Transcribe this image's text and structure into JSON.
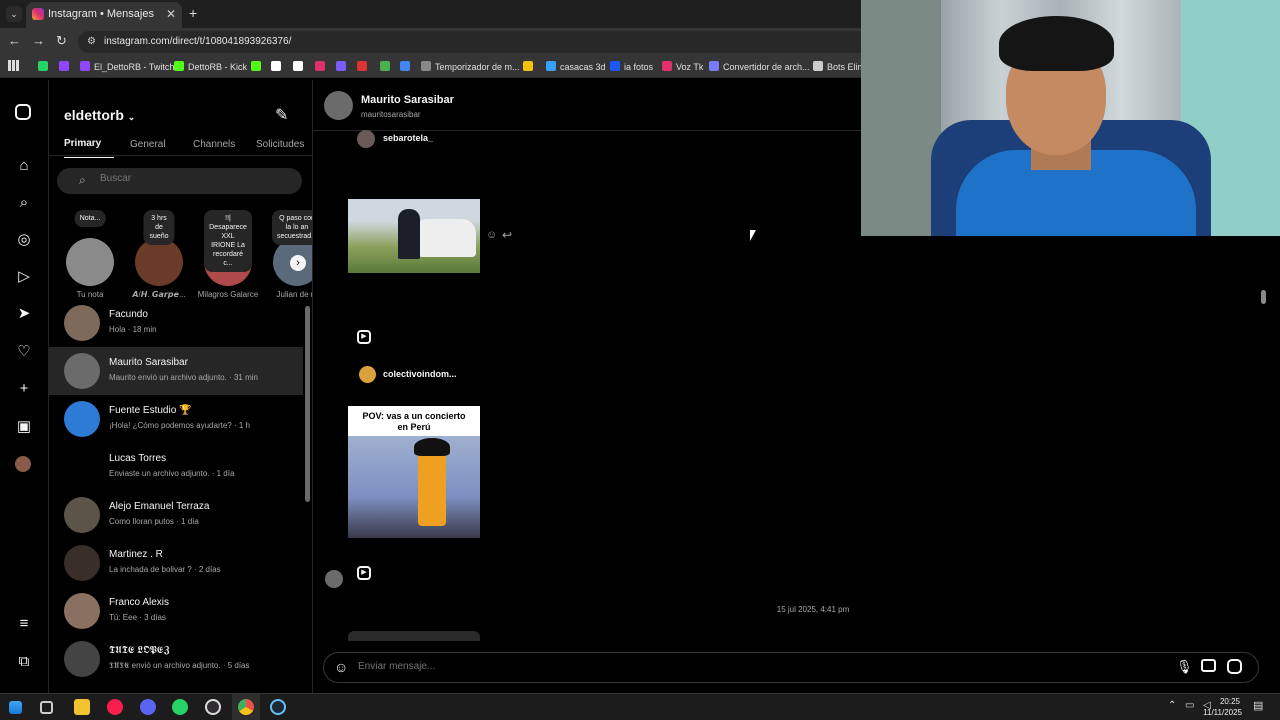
{
  "browser": {
    "tab_title": "Instagram • Mensajes",
    "url": "instagram.com/direct/t/108041893926376/",
    "bookmarks": [
      {
        "label": "",
        "color": "#25d366"
      },
      {
        "label": "",
        "color": "#9146ff"
      },
      {
        "label": "El_DettoRB - Twitch",
        "color": "#9146ff"
      },
      {
        "label": "DettoRB - Kick",
        "color": "#53fc18"
      },
      {
        "label": "",
        "color": "#53fc18"
      },
      {
        "label": "",
        "color": "#ffffff"
      },
      {
        "label": "",
        "color": "#ffffff"
      },
      {
        "label": "",
        "color": "#e1306c"
      },
      {
        "label": "",
        "color": "#7b5cff"
      },
      {
        "label": "",
        "color": "#d33"
      },
      {
        "label": "",
        "color": "#4caf50"
      },
      {
        "label": "",
        "color": "#4285f4"
      },
      {
        "label": "Temporizador de m...",
        "color": "#888888"
      },
      {
        "label": "",
        "color": "#f4c20d"
      },
      {
        "label": "casacas 3d",
        "color": "#3aa0ff"
      },
      {
        "label": "ia fotos",
        "color": "#1c57ff"
      },
      {
        "label": "Voz Tk",
        "color": "#e1306c"
      },
      {
        "label": "Convertidor de arch...",
        "color": "#7a7aff"
      },
      {
        "label": "Bots Elim",
        "color": "#cccccc"
      }
    ]
  },
  "inbox": {
    "username": "eldettorb",
    "tabs": [
      "Primary",
      "General",
      "Channels",
      "Solicitudes"
    ],
    "search_placeholder": "Buscar",
    "stories": [
      {
        "note": "Nota...",
        "name": "Tu nota",
        "color": "#8a8a8a"
      },
      {
        "note": "3 hrs de sueño",
        "name": "𝘼/𝙃. 𝙂𝙖𝙧𝙥𝙚...",
        "color": "#6b3b2a"
      },
      {
        "note": "!!| Desaparece XXL IRIONE La recordaré c...",
        "name": "Milagros Galarce",
        "color": "#b04a4a"
      },
      {
        "note": "Q paso con la lo an secuestrad...",
        "name": "Julian de m",
        "color": "#5a6a7a"
      }
    ],
    "conversations": [
      {
        "name": "Facundo",
        "preview": "Hola · 18 min",
        "color": "#7d6a5a"
      },
      {
        "name": "Maurito Sarasibar",
        "preview": "Maurito envió un archivo adjunto. · 31 min",
        "color": "#6b6b6b"
      },
      {
        "name": "Fuente Estudio 🏆",
        "preview": "¡Hola! ¿Cómo podemos ayudarte? · 1 h",
        "color": "#2e7bd6"
      },
      {
        "name": "Lucas Torres",
        "preview": "Enviaste un archivo adjunto. · 1 día",
        "color": "#000000"
      },
      {
        "name": "Alejo Emanuel Terraza",
        "preview": "Como lloran putos · 1 día",
        "color": "#5c5448"
      },
      {
        "name": "Martinez . R",
        "preview": "La inchada de bolivar ? · 2 días",
        "color": "#3a2e2a"
      },
      {
        "name": "Franco Alexis",
        "preview": "Tú: Eee · 3 días",
        "color": "#8a7060"
      },
      {
        "name": "𝕿𝖀𝕿𝕰 𝕷𝕺𝕻𝕰𝖅",
        "preview": "𝕿𝖀𝕿𝕰 envió un archivo adjunto. · 5 días",
        "color": "#444444"
      }
    ]
  },
  "chat": {
    "name": "Maurito Sarasibar",
    "handle": "mauritosarasibar",
    "share1_user": "sebarotela_",
    "share2_user": "colectivoindom...",
    "reel_text": "POV: vas a un concierto en Perú",
    "timestamp": "15 jul 2025, 4:41 pm",
    "input_placeholder": "Enviar mensaje..."
  },
  "taskbar": {
    "time": "20:25",
    "date": "11/11/2025"
  }
}
